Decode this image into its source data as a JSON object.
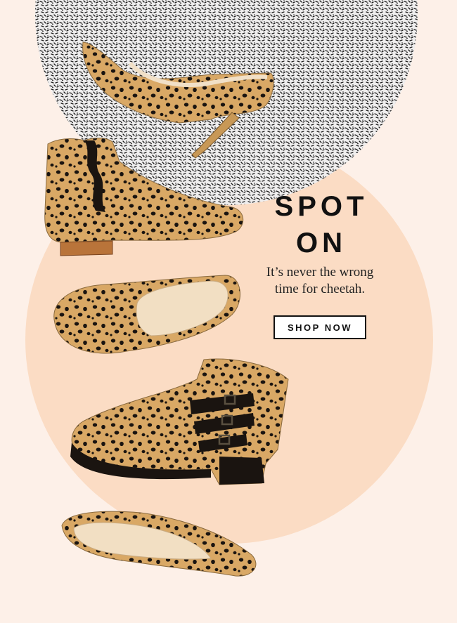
{
  "promo": {
    "headline_line1": "SPOT",
    "headline_line2": "ON",
    "tagline_line1": "It’s never the wrong",
    "tagline_line2": "time for cheetah.",
    "cta_label": "SHOP NOW"
  },
  "colors": {
    "background": "#fdf0e8",
    "circle": "#fbdcc4",
    "leopard_base": "#d9a865",
    "spot": "#1a1410",
    "text": "#111111"
  },
  "products": [
    {
      "name": "cheetah-heel-pump",
      "icon": "pump-heel-icon"
    },
    {
      "name": "cheetah-chelsea-boot",
      "icon": "chelsea-boot-icon"
    },
    {
      "name": "cheetah-loafer",
      "icon": "loafer-icon"
    },
    {
      "name": "cheetah-buckle-boot",
      "icon": "buckle-boot-icon"
    },
    {
      "name": "cheetah-flat-pump",
      "icon": "flat-pump-icon"
    }
  ]
}
